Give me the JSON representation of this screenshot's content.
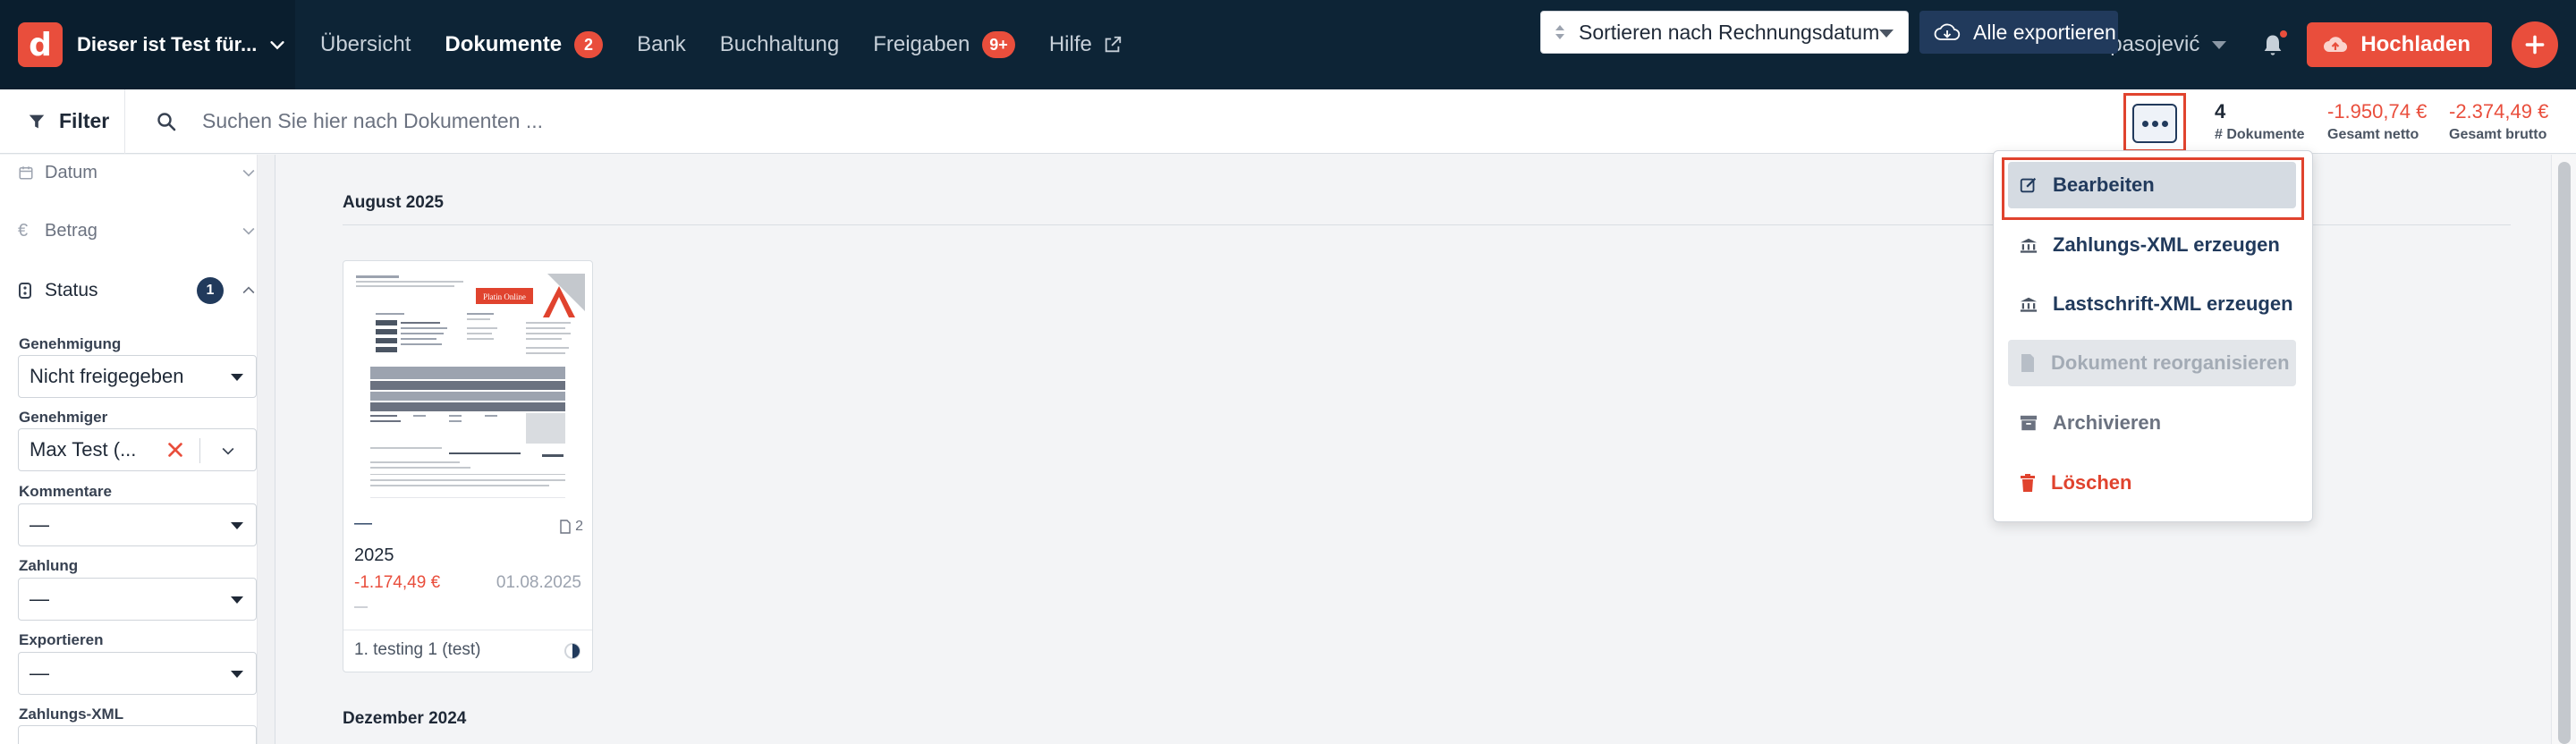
{
  "topnav": {
    "brand_logo": "d",
    "brand_name": "Dieser ist Test für...",
    "links": [
      {
        "label": "Übersicht"
      },
      {
        "label": "Dokumente",
        "badge": "2"
      },
      {
        "label": "Bank"
      },
      {
        "label": "Buchhaltung"
      },
      {
        "label": "Freigaben",
        "badge": "9+"
      },
      {
        "label": "Hilfe"
      }
    ],
    "user_name": "Nenad Spasojević",
    "upload_label": "Hochladen"
  },
  "toolbar": {
    "filter_label": "Filter",
    "search_placeholder": "Suchen Sie hier nach Dokumenten ...",
    "sort_label": "Sortieren nach Rechnungsdatum",
    "export_label": "Alle exportieren",
    "stats": {
      "count_value": "4",
      "count_label": "# Dokumente",
      "net_value": "-1.950,74 €",
      "net_label": "Gesamt netto",
      "gross_value": "-2.374,49 €",
      "gross_label": "Gesamt brutto"
    }
  },
  "sidebar": {
    "sections": {
      "date": "Datum",
      "amount": "Betrag",
      "status": "Status",
      "status_count": "1"
    },
    "fields": {
      "approval_label": "Genehmigung",
      "approval_value": "Nicht freigegeben",
      "approver_label": "Genehmiger",
      "approver_value": "Max Test (...",
      "comments_label": "Kommentare",
      "comments_value": "—",
      "payment_label": "Zahlung",
      "payment_value": "—",
      "export_label": "Exportieren",
      "export_value": "—",
      "paymentxml_label": "Zahlungs-XML"
    }
  },
  "main": {
    "month1": "August 2025",
    "month2": "Dezember 2024",
    "document": {
      "dash": "—",
      "pages": "2",
      "title": "2025",
      "amount": "-1.174,49 €",
      "date": "01.08.2025",
      "dash2": "—",
      "approval": "1. testing 1 (test)",
      "thumb_badge": "Platin Online"
    }
  },
  "dropdown": {
    "items": [
      {
        "label": "Bearbeiten"
      },
      {
        "label": "Zahlungs-XML erzeugen"
      },
      {
        "label": "Lastschrift-XML erzeugen"
      },
      {
        "label": "Dokument reorganisieren"
      },
      {
        "label": "Archivieren"
      },
      {
        "label": "Löschen"
      }
    ]
  },
  "colors": {
    "nav_bg": "#0d2436",
    "accent_red": "#e94e3c",
    "primary_navy": "#213a5c",
    "highlight_frame": "#e0432e"
  },
  "icons": [
    "brand-logo-icon",
    "chevron-down-icon",
    "external-link-icon",
    "bell-icon",
    "cloud-upload-icon",
    "plus-icon",
    "filter-icon",
    "search-icon",
    "sort-icon",
    "cloud-download-icon",
    "more-dots-icon",
    "calendar-icon",
    "euro-icon",
    "status-icon",
    "close-icon",
    "document-icon",
    "edit-icon",
    "bank-icon",
    "archive-icon",
    "trash-icon",
    "half-circle-icon"
  ]
}
